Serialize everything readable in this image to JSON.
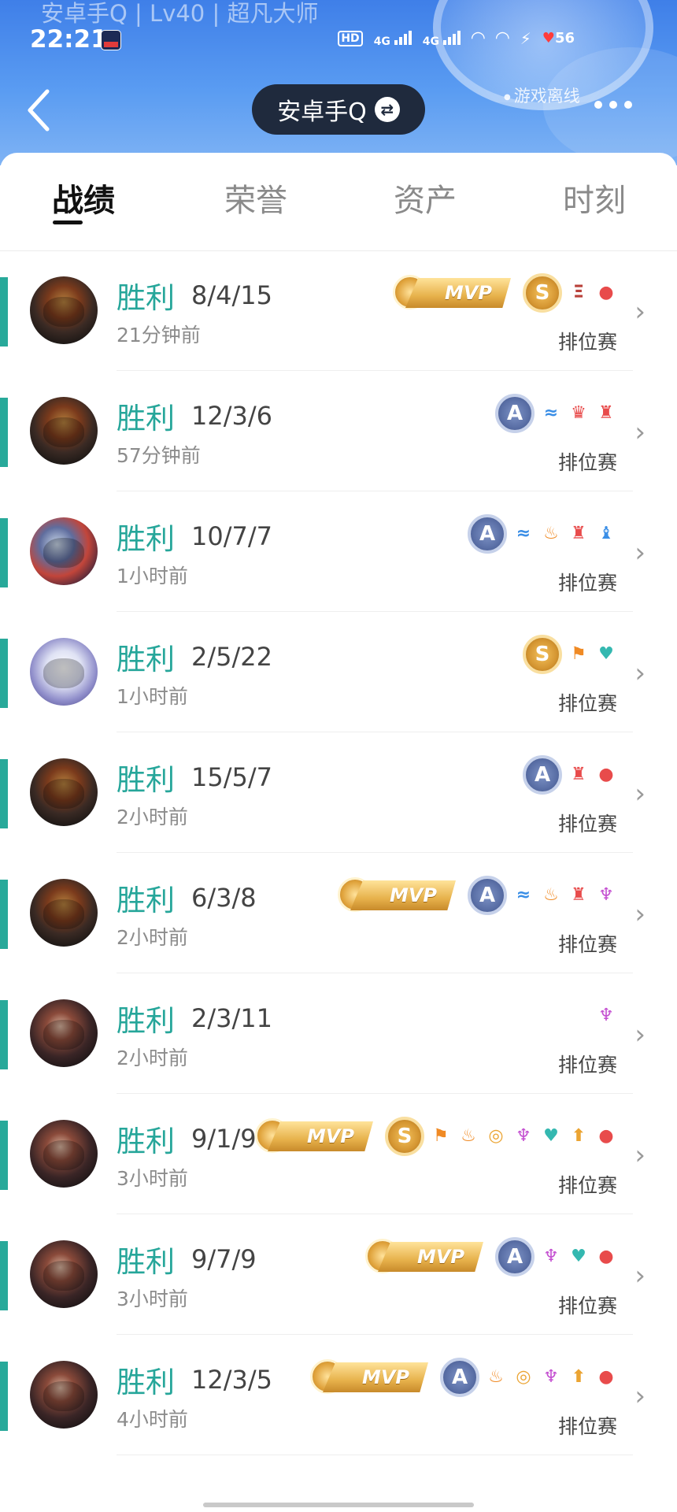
{
  "status_bar": {
    "faded_title": "安卓手Q | Lv40 | 超凡大师",
    "time": "22:21",
    "network_1": "4G",
    "network_2": "4G",
    "hd_label": "HD",
    "battery": "56"
  },
  "header": {
    "account_name": "安卓手Q",
    "online_status": "游戏离线"
  },
  "tabs": [
    {
      "label": "战绩",
      "active": true
    },
    {
      "label": "荣誉",
      "active": false
    },
    {
      "label": "资产",
      "active": false
    },
    {
      "label": "时刻",
      "active": false
    }
  ],
  "matches": [
    {
      "result": "胜利",
      "kda": "8/4/15",
      "time": "21分钟前",
      "mode": "排位赛",
      "mvp": true,
      "grade": "S",
      "achievements": [
        {
          "icon": "triple-kill-icon",
          "glyph": "Ξ",
          "color": "brown"
        },
        {
          "icon": "blood-drop-icon",
          "glyph": "●",
          "color": "red"
        }
      ]
    },
    {
      "result": "胜利",
      "kda": "12/3/6",
      "time": "57分钟前",
      "mode": "排位赛",
      "mvp": false,
      "grade": "A",
      "achievements": [
        {
          "icon": "wave-icon",
          "glyph": "≈",
          "color": "blue"
        },
        {
          "icon": "crown-icon",
          "glyph": "♛",
          "color": "red"
        },
        {
          "icon": "tower-icon",
          "glyph": "♜",
          "color": "red"
        }
      ]
    },
    {
      "result": "胜利",
      "kda": "10/7/7",
      "time": "1小时前",
      "mode": "排位赛",
      "mvp": false,
      "grade": "A",
      "achievements": [
        {
          "icon": "wave-icon",
          "glyph": "≈",
          "color": "blue"
        },
        {
          "icon": "flame-icon",
          "glyph": "♨",
          "color": "orange"
        },
        {
          "icon": "tower-icon",
          "glyph": "♜",
          "color": "red"
        },
        {
          "icon": "armor-icon",
          "glyph": "♝",
          "color": "blue"
        }
      ]
    },
    {
      "result": "胜利",
      "kda": "2/5/22",
      "time": "1小时前",
      "mode": "排位赛",
      "mvp": false,
      "grade": "S",
      "achievements": [
        {
          "icon": "flag-icon",
          "glyph": "⚑",
          "color": "orange"
        },
        {
          "icon": "heart-plus-icon",
          "glyph": "♥",
          "color": "teal"
        }
      ]
    },
    {
      "result": "胜利",
      "kda": "15/5/7",
      "time": "2小时前",
      "mode": "排位赛",
      "mvp": false,
      "grade": "A",
      "achievements": [
        {
          "icon": "tower-icon",
          "glyph": "♜",
          "color": "red"
        },
        {
          "icon": "blood-drop-icon",
          "glyph": "●",
          "color": "red"
        }
      ]
    },
    {
      "result": "胜利",
      "kda": "6/3/8",
      "time": "2小时前",
      "mode": "排位赛",
      "mvp": true,
      "grade": "A",
      "achievements": [
        {
          "icon": "wave-icon",
          "glyph": "≈",
          "color": "blue"
        },
        {
          "icon": "flame-icon",
          "glyph": "♨",
          "color": "orange"
        },
        {
          "icon": "tower-icon",
          "glyph": "♜",
          "color": "red"
        },
        {
          "icon": "demon-icon",
          "glyph": "♆",
          "color": "purple"
        }
      ]
    },
    {
      "result": "胜利",
      "kda": "2/3/11",
      "time": "2小时前",
      "mode": "排位赛",
      "mvp": false,
      "grade": "",
      "achievements": [
        {
          "icon": "demon-icon",
          "glyph": "♆",
          "color": "purple"
        }
      ]
    },
    {
      "result": "胜利",
      "kda": "9/1/9",
      "time": "3小时前",
      "mode": "排位赛",
      "mvp": true,
      "grade": "S",
      "achievements": [
        {
          "icon": "flag-icon",
          "glyph": "⚑",
          "color": "orange"
        },
        {
          "icon": "flame-icon",
          "glyph": "♨",
          "color": "orange"
        },
        {
          "icon": "coins-icon",
          "glyph": "◎",
          "color": "gold"
        },
        {
          "icon": "demon-icon",
          "glyph": "♆",
          "color": "purple"
        },
        {
          "icon": "heart-plus-icon",
          "glyph": "♥",
          "color": "teal"
        },
        {
          "icon": "gold-up-icon",
          "glyph": "⬆",
          "color": "gold"
        },
        {
          "icon": "blood-drop-icon",
          "glyph": "●",
          "color": "red"
        }
      ]
    },
    {
      "result": "胜利",
      "kda": "9/7/9",
      "time": "3小时前",
      "mode": "排位赛",
      "mvp": true,
      "grade": "A",
      "achievements": [
        {
          "icon": "demon-icon",
          "glyph": "♆",
          "color": "purple"
        },
        {
          "icon": "heart-plus-icon",
          "glyph": "♥",
          "color": "teal"
        },
        {
          "icon": "blood-drop-icon",
          "glyph": "●",
          "color": "red"
        }
      ]
    },
    {
      "result": "胜利",
      "kda": "12/3/5",
      "time": "4小时前",
      "mode": "排位赛",
      "mvp": true,
      "grade": "A",
      "achievements": [
        {
          "icon": "flame-icon",
          "glyph": "♨",
          "color": "orange"
        },
        {
          "icon": "coins-icon",
          "glyph": "◎",
          "color": "gold"
        },
        {
          "icon": "demon-icon",
          "glyph": "♆",
          "color": "purple"
        },
        {
          "icon": "gold-up-icon",
          "glyph": "⬆",
          "color": "gold"
        },
        {
          "icon": "blood-drop-icon",
          "glyph": "●",
          "color": "red"
        }
      ]
    }
  ],
  "mvp_label": "MVP",
  "colors": {
    "accent_teal": "#26a69a",
    "header_blue": "#3f7fe8",
    "pill_dark": "#1f2a3d"
  }
}
